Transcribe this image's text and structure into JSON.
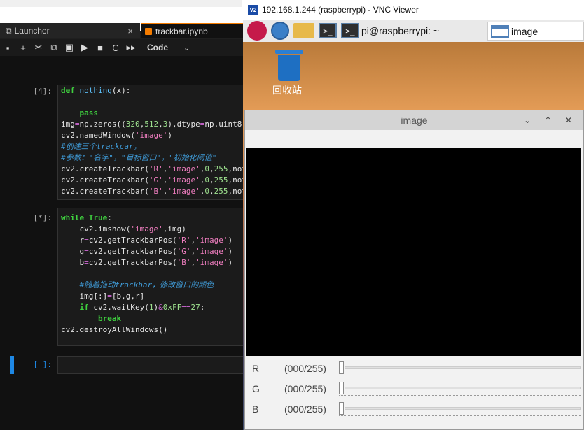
{
  "jupyter": {
    "tabs": [
      {
        "label": "Launcher",
        "close": "×"
      },
      {
        "label": "trackbar.ipynb"
      }
    ],
    "toolbar": {
      "kernel": "Code",
      "chevron": "⌄",
      "icons": [
        "💾",
        "+",
        "✂",
        "⧉",
        "📋",
        "▶",
        "■",
        "C",
        "▸▸"
      ]
    },
    "cells": [
      {
        "prompt": "[4]:",
        "lines": []
      },
      {
        "prompt": "[*]:",
        "lines": []
      },
      {
        "prompt": "[ ]:",
        "lines": []
      }
    ]
  },
  "vnc": {
    "title": "192.168.1.244 (raspberrypi) - VNC Viewer",
    "logo": "V2",
    "panel": {
      "terminal_task": "pi@raspberrypi: ~",
      "image_task": "image"
    },
    "desktop": {
      "trash_label": "回收站"
    },
    "image_window": {
      "title": "image",
      "controls": "⌄ ⌃ ✕",
      "trackbars": [
        {
          "name": "R",
          "value": "(000/255)",
          "level": 0
        },
        {
          "name": "G",
          "value": "(000/255)",
          "level": 0
        },
        {
          "name": "B",
          "value": "(000/255)",
          "level": 0
        }
      ]
    }
  }
}
